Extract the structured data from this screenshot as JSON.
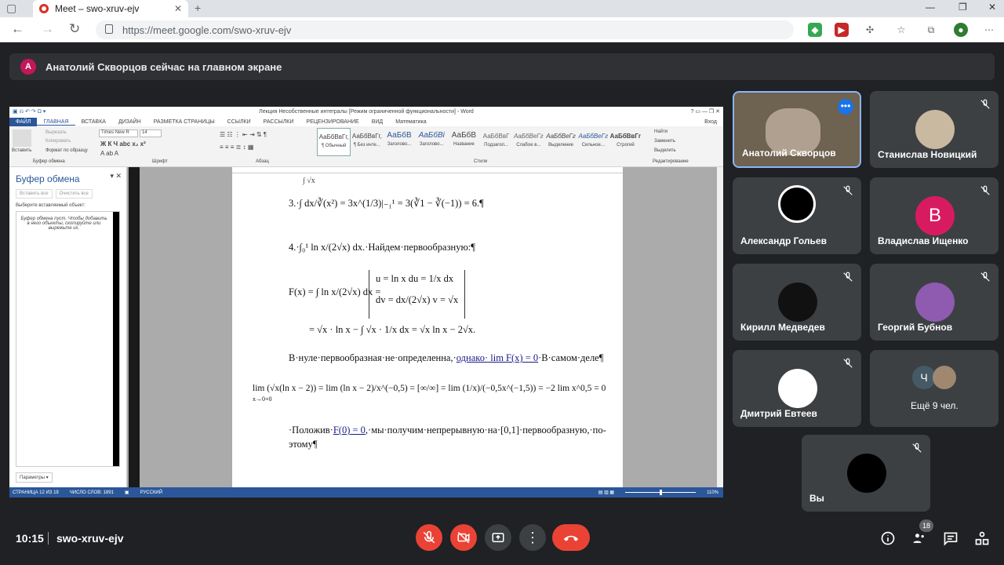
{
  "browser": {
    "tab_title": "Meet – swo-xruv-ejv",
    "url": "https://meet.google.com/swo-xruv-ejv"
  },
  "banner": {
    "avatar": "А",
    "text": "Анатолий Скворцов сейчас на главном экране"
  },
  "word": {
    "title": "Лекция Несобственные интегралы [Режим ограниченной функциональности] - Word",
    "signin": "Вход",
    "tabs": [
      "ФАЙЛ",
      "ГЛАВНАЯ",
      "ВСТАВКА",
      "ДИЗАЙН",
      "РАЗМЕТКА СТРАНИЦЫ",
      "ССЫЛКИ",
      "РАССЫЛКИ",
      "РЕЦЕНЗИРОВАНИЕ",
      "ВИД",
      "Математика"
    ],
    "paste": "Вставить",
    "cut": "Вырезать",
    "copy": "Копировать",
    "format_painter": "Формат по образцу",
    "clipboard_group": "Буфер обмена",
    "font": "Times New R",
    "size": "14",
    "font_group": "Шрифт",
    "paragraph_group": "Абзац",
    "styles_group": "Стили",
    "editing_group": "Редактирование",
    "styles": [
      {
        "p": "АаБбВвГг,",
        "n": "¶ Обычный"
      },
      {
        "p": "АаБбВвГг,",
        "n": "¶ Без инте..."
      },
      {
        "p": "АаБбВ",
        "n": "Заголово..."
      },
      {
        "p": "АаБбВі",
        "n": "Заголово..."
      },
      {
        "p": "АаБбВ",
        "n": "Название"
      },
      {
        "p": "АаБбВвГ",
        "n": "Подзагол..."
      },
      {
        "p": "АаБбВеГг",
        "n": "Слабое в..."
      },
      {
        "p": "АаБбВеГг",
        "n": "Выделение"
      },
      {
        "p": "АаБбВеГг",
        "n": "Сильное..."
      },
      {
        "p": "АаБбВвГг",
        "n": "Строгий"
      }
    ],
    "find": "Найти",
    "replace": "Заменить",
    "select": "Выделить",
    "clip_pane": {
      "title": "Буфер обмена",
      "paste_all": "Вставить все",
      "clear_all": "Очистить все",
      "choose": "Выберите вставляемый объект:",
      "empty": "Буфер обмена пуст. Чтобы добавить в него объекты, скопируйте или вырежьте их.",
      "params": "Параметры"
    },
    "status": {
      "page": "СТРАНИЦА 12 ИЗ 19",
      "words": "ЧИСЛО СЛОВ: 1891",
      "lang": "РУССКИЙ",
      "zoom": "110%"
    },
    "doc": {
      "l1": "3.·∫ dx/∛(x²) = 3x^(1/3)|₋₁¹ = 3(∛1 − ∛(−1)) = 6.¶",
      "l2a": "4.·∫₀¹ ln x/(2√x) dx",
      "l2b": ".·Найдем·первообразную:¶",
      "l3a": "F(x) = ∫ ln x/(2√x) dx =",
      "l3b": "u = ln x     du = 1/x dx",
      "l3c": "dv = dx/(2√x)     v = √x",
      "l4": "= √x · ln x − ∫ √x · 1/x dx = √x ln x − 2√x.",
      "l5a": "В·нуле·первообразная·не·определенна,·",
      "l5b": "однако· lim F(x) = 0",
      "l5c": "·В·самом·деле¶",
      "l6": "lim (√x(ln x − 2)) = lim (ln x − 2)/x^(−0,5) = [∞/∞] = lim (1/x)/(−0,5x^(−1,5)) = −2 lim x^0,5 = 0",
      "l6sub": "x→0+0",
      "l7a": "·Положив·",
      "l7b": "F(0) = 0",
      "l7c": ",·мы·получим·непрерывную·на·[0,1]·первообразную,·по-",
      "l8": "этому¶"
    }
  },
  "participants": [
    {
      "name": "Анатолий Скворцов"
    },
    {
      "name": "Станислав Новицкий"
    },
    {
      "name": "Александр Гольев"
    },
    {
      "name": "Владислав Ищенко",
      "initial": "В",
      "color": "#d81b60"
    },
    {
      "name": "Кирилл Медведев"
    },
    {
      "name": "Георгий Бубнов"
    },
    {
      "name": "Дмитрий Евтеев"
    },
    {
      "name": "Ещё 9 чел.",
      "initial": "Ч"
    },
    {
      "name": "Вы"
    }
  ],
  "bottom": {
    "time": "10:15",
    "code": "swo-xruv-ejv",
    "people_count": "18"
  }
}
